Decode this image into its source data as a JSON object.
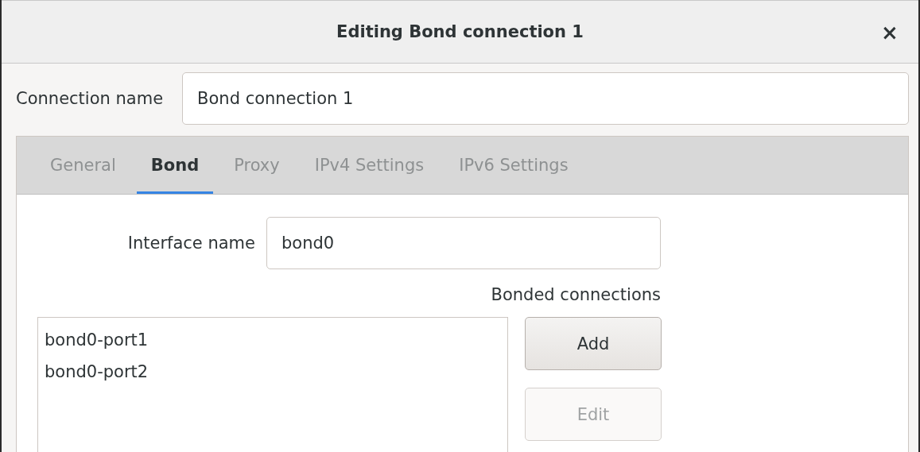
{
  "window": {
    "title": "Editing Bond connection 1",
    "close": "×"
  },
  "connection_name": {
    "label": "Connection name",
    "value": "Bond connection 1"
  },
  "tabs": [
    {
      "label": "General",
      "selected": false
    },
    {
      "label": "Bond",
      "selected": true
    },
    {
      "label": "Proxy",
      "selected": false
    },
    {
      "label": "IPv4 Settings",
      "selected": false
    },
    {
      "label": "IPv6 Settings",
      "selected": false
    }
  ],
  "bond": {
    "interface_name": {
      "label": "Interface name",
      "value": "bond0"
    },
    "bonded_connections": {
      "label": "Bonded connections",
      "items": [
        {
          "name": "bond0-port1"
        },
        {
          "name": "bond0-port2"
        }
      ]
    },
    "buttons": [
      {
        "label": "Add",
        "disabled": false
      },
      {
        "label": "Edit",
        "disabled": true
      }
    ]
  }
}
